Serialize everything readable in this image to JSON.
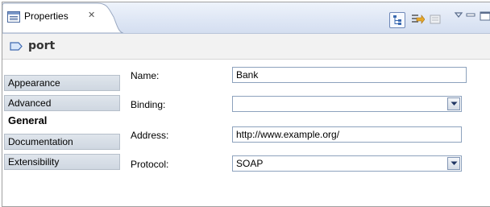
{
  "tab": {
    "title": "Properties",
    "close_glyph": "✕"
  },
  "header": {
    "title": "port"
  },
  "sidebar": {
    "items": [
      {
        "label": "Appearance"
      },
      {
        "label": "Advanced"
      },
      {
        "label": "General"
      },
      {
        "label": "Documentation"
      },
      {
        "label": "Extensibility"
      }
    ],
    "selected": "General"
  },
  "form": {
    "name": {
      "label": "Name:",
      "value": "Bank"
    },
    "binding": {
      "label": "Binding:",
      "value": ""
    },
    "address": {
      "label": "Address:",
      "value": "http://www.example.org/"
    },
    "protocol": {
      "label": "Protocol:",
      "value": "SOAP"
    }
  },
  "icons": {
    "tab": "properties-view-icon",
    "toolbar": [
      "categories-icon",
      "filter-advanced-icon",
      "restore-default-icon",
      "view-menu-icon",
      "minimize-icon",
      "maximize-icon"
    ],
    "title": "port-icon"
  }
}
